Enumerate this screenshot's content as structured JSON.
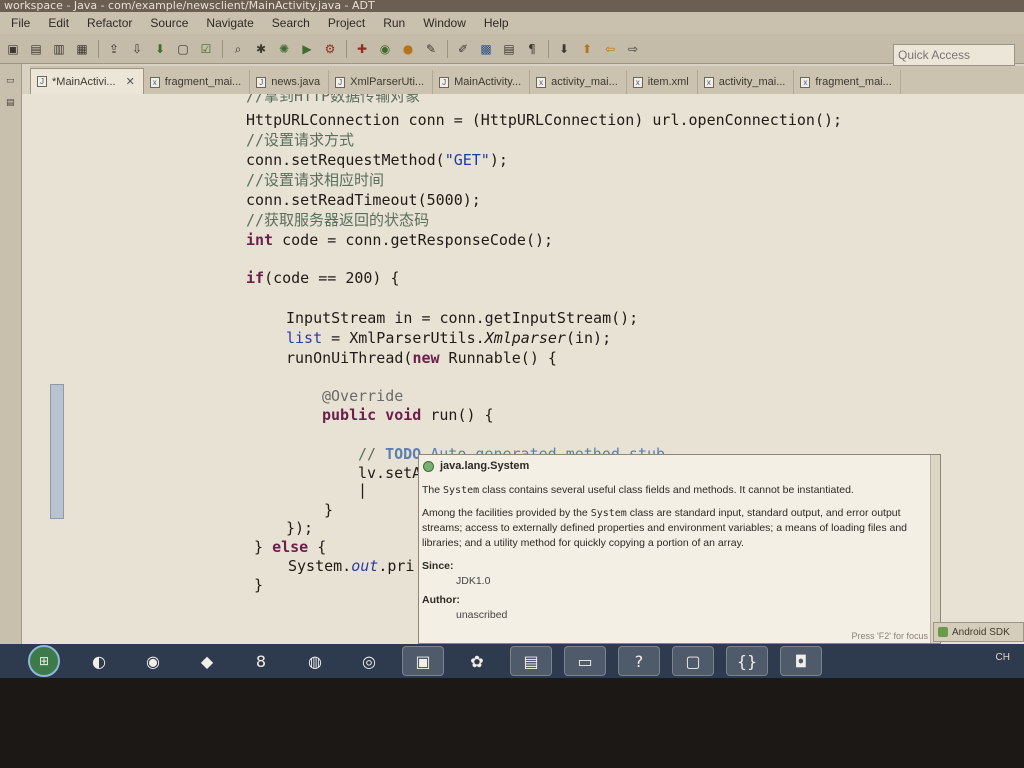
{
  "window": {
    "title": "workspace - Java - com/example/newsclient/MainActivity.java - ADT"
  },
  "menubar": [
    "File",
    "Edit",
    "Refactor",
    "Source",
    "Navigate",
    "Search",
    "Project",
    "Run",
    "Window",
    "Help"
  ],
  "toolbar": {
    "quick_access_placeholder": "Quick Access",
    "buttons": [
      "new-icon",
      "save-icon",
      "save-all-icon",
      "print-icon",
      "import-icon",
      "export-icon",
      "android-sdk-manager-icon",
      "avd-manager-icon",
      "lint-icon",
      "search-icon",
      "skip-breakpoints-icon",
      "debug-icon",
      "run-icon",
      "external-tools-icon",
      "new-java-project-icon",
      "new-package-icon",
      "new-class-icon",
      "open-type-icon",
      "search-file-icon",
      "open-task-icon",
      "toggle-mark-occurrences-icon",
      "show-whitespace-icon",
      "next-annotation-icon",
      "previous-annotation-icon",
      "back-icon",
      "forward-icon"
    ]
  },
  "tabs": [
    {
      "label": "*MainActivi...",
      "active": true,
      "close": "✕"
    },
    {
      "label": "fragment_mai...",
      "active": false
    },
    {
      "label": "news.java",
      "active": false
    },
    {
      "label": "XmlParserUti...",
      "active": false
    },
    {
      "label": "MainActivity...",
      "active": false
    },
    {
      "label": "activity_mai...",
      "active": false
    },
    {
      "label": "item.xml",
      "active": false
    },
    {
      "label": "activity_mai...",
      "active": false
    },
    {
      "label": "fragment_mai...",
      "active": false
    }
  ],
  "code": {
    "line0": "//拿到HTTP数据传输对象",
    "line1": "HttpURLConnection conn = (HttpURLConnection) url.openConnection();",
    "line2": "//设置请求方式",
    "line3a": "conn.setRequestMethod(",
    "line3b": "\"GET\"",
    "line3c": ");",
    "line4": "//设置请求相应时间",
    "line5": "conn.setReadTimeout(5000);",
    "line6": "//获取服务器返回的状态码",
    "line7a": "int",
    "line7b": " code = conn.getResponseCode();",
    "line9a": "if",
    "line9b": "(code == 200) {",
    "line11": "InputStream in = conn.getInputStream();",
    "line12a": "list",
    "line12b": " = XmlParserUtils.",
    "line12c": "Xmlparser",
    "line12d": "(in);",
    "line13a": "runOnUiThread(",
    "line13b": "new",
    "line13c": " Runnable() {",
    "line15": "@Override",
    "line16a": "public",
    "line16b": " ",
    "line16c": "void",
    "line16d": " run() {",
    "line18a": "// ",
    "line18b": "TODO",
    "line18c": " Auto-generated method stub",
    "line19": "lv.setA",
    "line20": "|",
    "line21": "}",
    "line22": "});",
    "line23a": "} ",
    "line23b": "else",
    "line23c": " {",
    "line24a": "System.",
    "line24b": "out",
    "line24c": ".pri",
    "line25": "}"
  },
  "tooltip": {
    "title": "java.lang.System",
    "p1_a": "The ",
    "p1_code": "System",
    "p1_b": " class contains several useful class fields and methods. It cannot be instantiated.",
    "p2_a": "Among the facilities provided by the ",
    "p2_code": "System",
    "p2_b": " class are standard input, standard output, and error output streams; access to externally defined properties and environment variables; a means of loading files and libraries; and a utility method for quickly copying a portion of an array.",
    "since_label": "Since:",
    "since_value": "JDK1.0",
    "author_label": "Author:",
    "author_value": "unascribed",
    "footer": "Press 'F2' for focus"
  },
  "status": {
    "android_sdk": "Android SDK"
  },
  "taskbar": {
    "items": [
      "start-orb",
      "chrome-icon",
      "media-player-icon",
      "app-icon",
      "eclipse-icon",
      "media-icon",
      "game-icon",
      "file-explorer-icon",
      "android-icon",
      "network-icon",
      "folder-icon",
      "help-icon",
      "documents-icon",
      "braces-icon",
      "disk-icon"
    ],
    "tray": "CH"
  },
  "colors": {
    "background": "#e8e2d4",
    "keyword": "#6b1f4a",
    "comment": "#5a6f5c",
    "string": "#1d3aa6",
    "field": "#2a3ea0"
  }
}
